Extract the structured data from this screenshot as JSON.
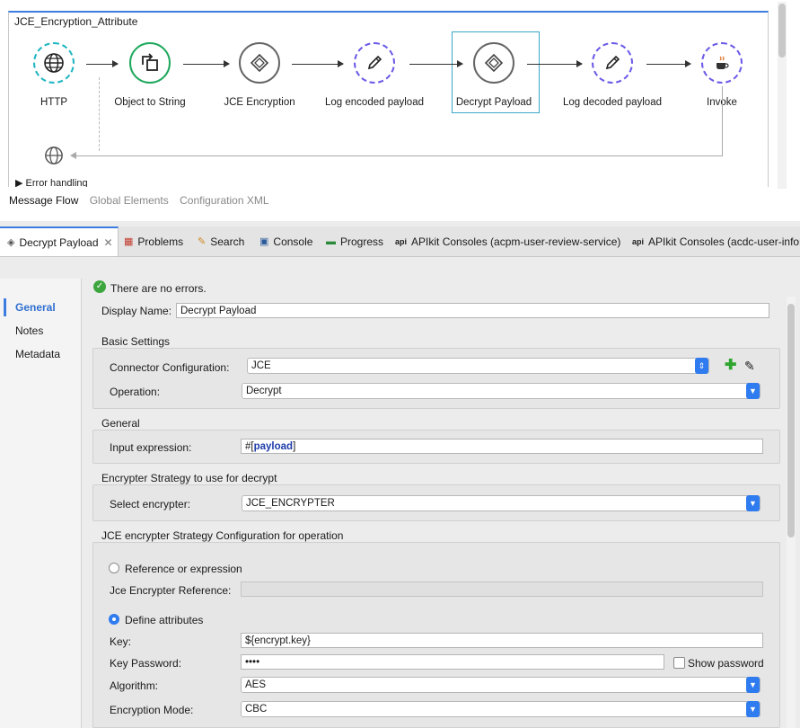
{
  "canvas": {
    "flow_title": "JCE_Encryption_Attribute",
    "nodes": [
      {
        "label": "HTTP",
        "icon": "globe-icon"
      },
      {
        "label": "Object to String",
        "icon": "transform-icon"
      },
      {
        "label": "JCE Encryption",
        "icon": "jce-icon"
      },
      {
        "label": "Log encoded payload",
        "icon": "pencil-icon"
      },
      {
        "label": "Decrypt Payload",
        "icon": "jce-icon"
      },
      {
        "label": "Log decoded payload",
        "icon": "pencil-icon"
      },
      {
        "label": "Invoke",
        "icon": "java-cup-icon"
      }
    ],
    "error_handling": "Error handling",
    "view_tabs": [
      "Message Flow",
      "Global Elements",
      "Configuration XML"
    ],
    "colors": {
      "http": "#1fb5c1",
      "transform": "#1ea85c",
      "jce": "#666666",
      "logger": "#6a5ae8",
      "accent": "#3d7de0"
    }
  },
  "tabs": [
    {
      "label": "Decrypt Payload",
      "icon": "jce-icon"
    },
    {
      "label": "Problems",
      "icon": "problems-icon"
    },
    {
      "label": "Search",
      "icon": "search-icon"
    },
    {
      "label": "Console",
      "icon": "console-icon"
    },
    {
      "label": "Progress",
      "icon": "progress-icon"
    },
    {
      "label": "APIkit Consoles (acpm-user-review-service)",
      "icon": "api-icon"
    },
    {
      "label": "APIkit Consoles (acdc-user-infor",
      "icon": "api-icon"
    }
  ],
  "nav": [
    "General",
    "Notes",
    "Metadata"
  ],
  "status": "There are no errors.",
  "form": {
    "display_name_label": "Display Name:",
    "display_name": "Decrypt Payload",
    "basic_settings": "Basic Settings",
    "connector_config_label": "Connector Configuration:",
    "connector_config": "JCE",
    "operation_label": "Operation:",
    "operation": "Decrypt",
    "general_header": "General",
    "input_expression_label": "Input expression:",
    "input_prefix": "#[",
    "input_keyword": "payload",
    "input_suffix": "]",
    "strategy_header": "Encrypter Strategy to use for decrypt",
    "select_encrypter_label": "Select encrypter:",
    "select_encrypter": "JCE_ENCRYPTER",
    "jce_config_header": "JCE encrypter Strategy Configuration for operation",
    "ref_radio": "Reference or expression",
    "jce_ref_label": "Jce Encrypter Reference:",
    "define_radio": "Define attributes",
    "key_label": "Key:",
    "key": "${encrypt.key}",
    "key_password_label": "Key Password:",
    "key_password": "••••",
    "show_password": "Show password",
    "algorithm_label": "Algorithm:",
    "algorithm": "AES",
    "mode_label": "Encryption Mode:",
    "mode": "CBC"
  }
}
